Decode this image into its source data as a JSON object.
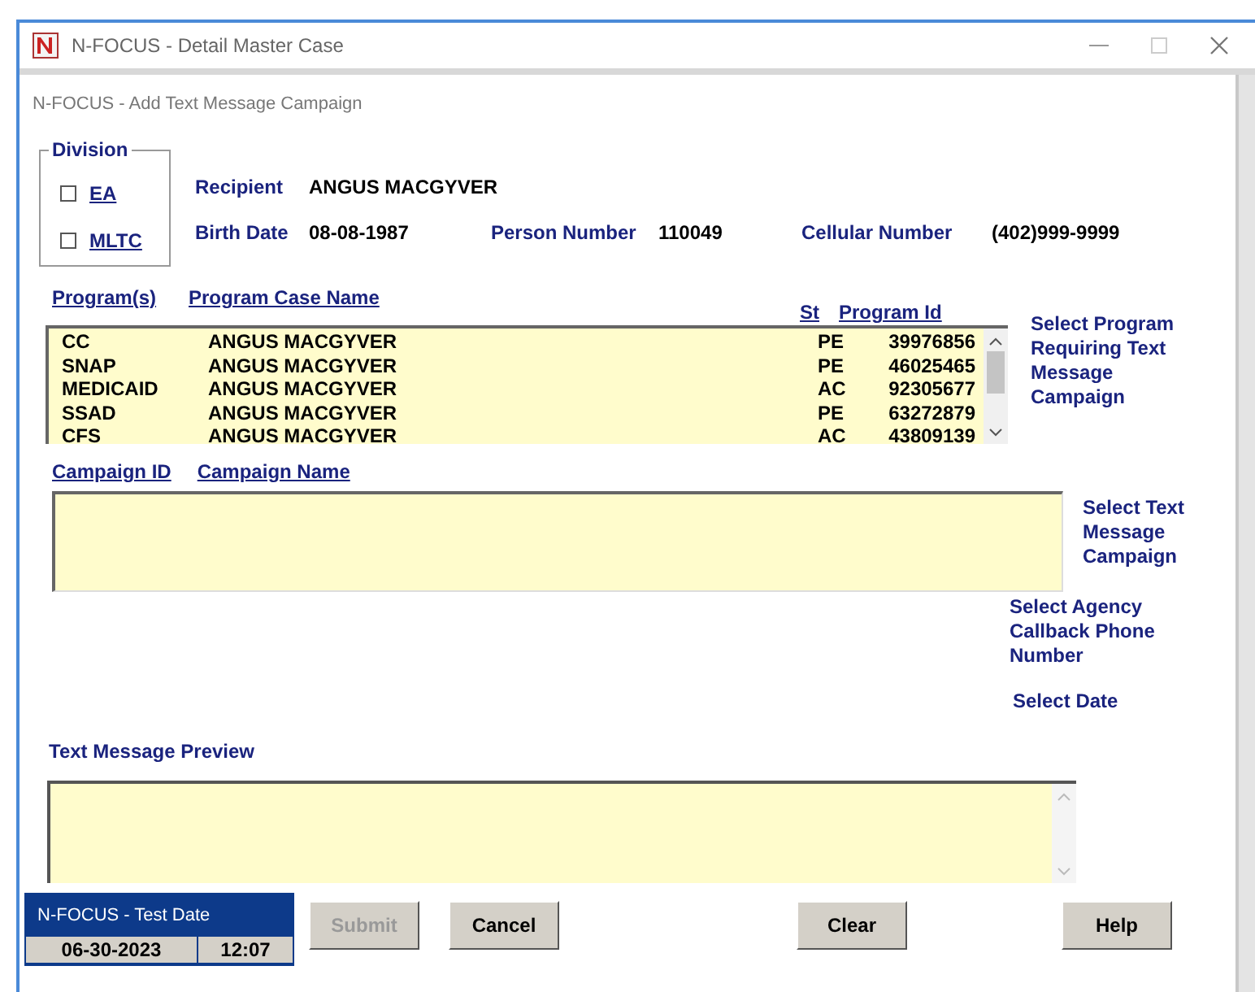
{
  "window": {
    "title": "N-FOCUS - Detail Master Case"
  },
  "dialog": {
    "title": "N-FOCUS - Add Text Message Campaign"
  },
  "division": {
    "label": "Division",
    "options": [
      {
        "label": "EA",
        "checked": false
      },
      {
        "label": "MLTC",
        "checked": false
      }
    ]
  },
  "person": {
    "recipient_label": "Recipient",
    "recipient": "ANGUS MACGYVER",
    "birth_date_label": "Birth Date",
    "birth_date": "08-08-1987",
    "person_number_label": "Person Number",
    "person_number": "110049",
    "cellular_label": "Cellular Number",
    "cellular": "(402)999-9999"
  },
  "programs": {
    "columns": [
      "Program(s)",
      "Program Case Name",
      "St",
      "Program Id"
    ],
    "hint": "Select Program Requiring Text Message Campaign",
    "rows": [
      {
        "program": "CC",
        "name": "ANGUS MACGYVER",
        "st": "PE",
        "id": "39976856",
        "selected": false
      },
      {
        "program": "SNAP",
        "name": "ANGUS MACGYVER",
        "st": "PE",
        "id": "46025465",
        "selected": false
      },
      {
        "program": "MEDICAID",
        "name": "ANGUS MACGYVER",
        "st": "AC",
        "id": "92305677",
        "selected": false
      },
      {
        "program": "SSAD",
        "name": "ANGUS MACGYVER",
        "st": "PE",
        "id": "63272879",
        "selected": false
      },
      {
        "program": "CFS",
        "name": "ANGUS MACGYVER",
        "st": "AC",
        "id": "43809139",
        "selected": false
      }
    ]
  },
  "campaigns": {
    "columns": [
      "Campaign ID",
      "Campaign Name"
    ],
    "hint": "Select Text Message Campaign"
  },
  "callback_label": "Select Agency Callback Phone Number",
  "date_label": "Select Date",
  "preview": {
    "label": "Text Message Preview"
  },
  "test_date": {
    "title": "N-FOCUS - Test Date",
    "date": "06-30-2023",
    "time": "12:07"
  },
  "buttons": [
    {
      "label": "Submit",
      "disabled": true
    },
    {
      "label": "Cancel",
      "disabled": false
    },
    {
      "label": "Clear",
      "disabled": false
    },
    {
      "label": "Help",
      "disabled": false
    }
  ]
}
